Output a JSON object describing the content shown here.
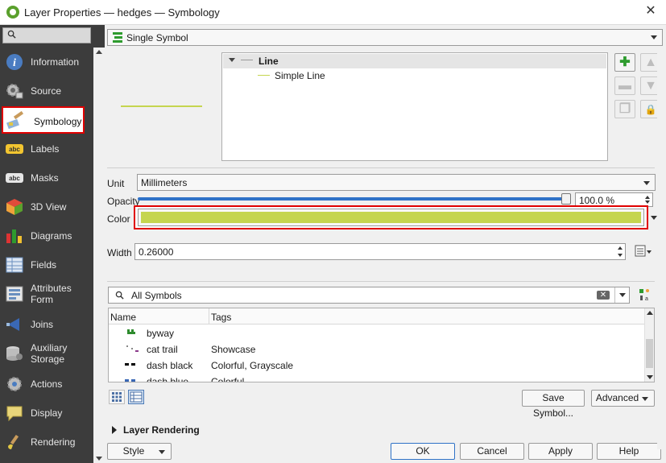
{
  "window": {
    "title": "Layer Properties — hedges — Symbology",
    "close_glyph": "✕"
  },
  "sidebar": {
    "search_placeholder": "",
    "items": [
      {
        "label": "Information",
        "icon": "information-icon"
      },
      {
        "label": "Source",
        "icon": "source-gear-icon"
      },
      {
        "label": "Symbology",
        "icon": "symbology-paintbrush-icon",
        "active": true
      },
      {
        "label": "Labels",
        "icon": "labels-abc-icon"
      },
      {
        "label": "Masks",
        "icon": "masks-abc-icon"
      },
      {
        "label": "3D View",
        "icon": "cube-3d-icon"
      },
      {
        "label": "Diagrams",
        "icon": "diagrams-icon"
      },
      {
        "label": "Fields",
        "icon": "fields-table-icon"
      },
      {
        "label": "Attributes Form",
        "label_line1": "Attributes",
        "label_line2": "Form",
        "icon": "attributes-form-icon"
      },
      {
        "label": "Joins",
        "icon": "joins-icon"
      },
      {
        "label": "Auxiliary Storage",
        "label_line1": "Auxiliary",
        "label_line2": "Storage",
        "icon": "auxiliary-storage-icon"
      },
      {
        "label": "Actions",
        "icon": "actions-gear-icon"
      },
      {
        "label": "Display",
        "icon": "display-speech-bubble-icon"
      },
      {
        "label": "Rendering",
        "icon": "rendering-paintbrush-icon"
      }
    ]
  },
  "renderer": {
    "selected": "Single Symbol",
    "icon": "single-symbol-icon"
  },
  "symbol_tree": {
    "root_label": "Line",
    "child_label": "Simple Line"
  },
  "symbol_tree_buttons": [
    {
      "name": "add-layer-button",
      "glyph": "✚",
      "enabled": true
    },
    {
      "name": "move-up-button",
      "glyph": "▲",
      "enabled": false
    },
    {
      "name": "remove-layer-button",
      "glyph": "▬",
      "enabled": false
    },
    {
      "name": "move-down-button",
      "glyph": "▼",
      "enabled": false
    },
    {
      "name": "duplicate-layer-button",
      "glyph": "❐",
      "enabled": false
    },
    {
      "name": "lock-layer-button",
      "glyph": "🔒",
      "enabled": false
    }
  ],
  "unit": {
    "label": "Unit",
    "value": "Millimeters"
  },
  "opacity": {
    "label": "Opacity",
    "value_text": "100.0 %",
    "fraction": 1.0
  },
  "color": {
    "label": "Color",
    "value": "#c5d54f"
  },
  "width": {
    "label": "Width",
    "value": "0.26000"
  },
  "symbol_search": {
    "value": "All Symbols"
  },
  "symbol_table": {
    "columns": [
      "Name",
      "Tags"
    ],
    "rows": [
      {
        "name": "byway",
        "tags": "",
        "swatch": "#2e8b2e"
      },
      {
        "name": "cat trail",
        "tags": "Showcase",
        "swatch": "#8a8a8a"
      },
      {
        "name": "dash  black",
        "tags": "Colorful, Grayscale",
        "swatch": "#000000"
      },
      {
        "name": "dash blue",
        "tags": "Colorful",
        "swatch": "#3a68b5"
      }
    ]
  },
  "buttons": {
    "save_symbol": "Save Symbol...",
    "advanced": "Advanced",
    "style": "Style",
    "ok": "OK",
    "cancel": "Cancel",
    "apply": "Apply",
    "help": "Help"
  },
  "layer_rendering": {
    "label": "Layer Rendering"
  },
  "colors": {
    "highlight": "#e00000",
    "sidebar_bg": "#3c3c3c",
    "accent": "#2f72c7"
  }
}
